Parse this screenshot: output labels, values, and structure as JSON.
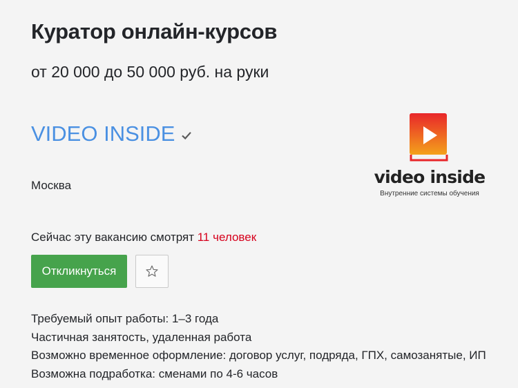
{
  "vacancy": {
    "title": "Куратор онлайн-курсов",
    "salary": "от 20 000 до 50 000 руб. на руки"
  },
  "company": {
    "name": "VIDEO INSIDE",
    "verified_icon": "check-icon",
    "city": "Москва",
    "logo": {
      "text": "video inside",
      "subtitle": "Внутренние системы обучения",
      "colors": {
        "gradient_top": "#e8262a",
        "gradient_bottom": "#f4a21b",
        "text": "#222222"
      }
    }
  },
  "watching": {
    "text": "Сейчас эту вакансию смотрят ",
    "count": "11 человек",
    "count_color": "#d6001c"
  },
  "actions": {
    "apply_label": "Откликнуться",
    "apply_color": "#46a34c",
    "favorite_icon": "star-icon"
  },
  "details": [
    "Требуемый опыт работы: 1–3 года",
    "Частичная занятость, удаленная работа",
    "Возможно временное оформление: договор услуг, подряда, ГПХ, самозанятые, ИП",
    "Возможна подработка: сменами по 4-6 часов"
  ]
}
